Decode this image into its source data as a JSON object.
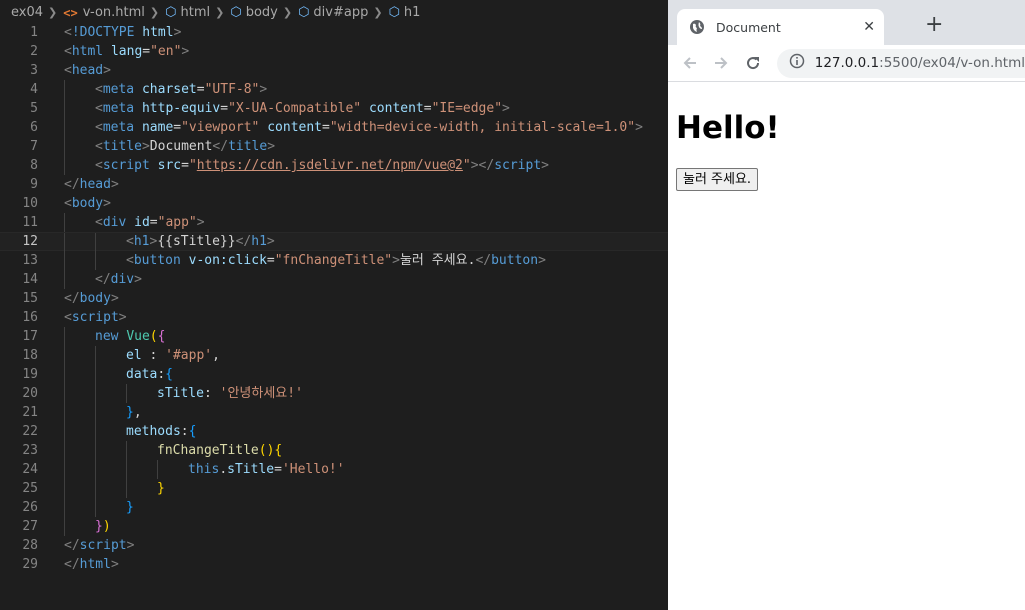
{
  "editor": {
    "breadcrumb": {
      "folder": "ex04",
      "file": "v-on.html",
      "path": [
        "html",
        "body",
        "div#app",
        "h1"
      ]
    },
    "current_line": 12,
    "lines": [
      {
        "n": "1",
        "indent": 0,
        "tokens": [
          [
            "br",
            "<"
          ],
          [
            "tag",
            "!DOCTYPE"
          ],
          [
            "txt",
            " "
          ],
          [
            "attr",
            "html"
          ],
          [
            "br",
            ">"
          ]
        ]
      },
      {
        "n": "2",
        "indent": 0,
        "tokens": [
          [
            "br",
            "<"
          ],
          [
            "tag",
            "html"
          ],
          [
            "txt",
            " "
          ],
          [
            "attr",
            "lang"
          ],
          [
            "txt",
            "="
          ],
          [
            "str",
            "\"en\""
          ],
          [
            "br",
            ">"
          ]
        ]
      },
      {
        "n": "3",
        "indent": 0,
        "tokens": [
          [
            "br",
            "<"
          ],
          [
            "tag",
            "head"
          ],
          [
            "br",
            ">"
          ]
        ]
      },
      {
        "n": "4",
        "indent": 1,
        "tokens": [
          [
            "br",
            "<"
          ],
          [
            "tag",
            "meta"
          ],
          [
            "txt",
            " "
          ],
          [
            "attr",
            "charset"
          ],
          [
            "txt",
            "="
          ],
          [
            "str",
            "\"UTF-8\""
          ],
          [
            "br",
            ">"
          ]
        ]
      },
      {
        "n": "5",
        "indent": 1,
        "tokens": [
          [
            "br",
            "<"
          ],
          [
            "tag",
            "meta"
          ],
          [
            "txt",
            " "
          ],
          [
            "attr",
            "http-equiv"
          ],
          [
            "txt",
            "="
          ],
          [
            "str",
            "\"X-UA-Compatible\""
          ],
          [
            "txt",
            " "
          ],
          [
            "attr",
            "content"
          ],
          [
            "txt",
            "="
          ],
          [
            "str",
            "\"IE=edge\""
          ],
          [
            "br",
            ">"
          ]
        ]
      },
      {
        "n": "6",
        "indent": 1,
        "tokens": [
          [
            "br",
            "<"
          ],
          [
            "tag",
            "meta"
          ],
          [
            "txt",
            " "
          ],
          [
            "attr",
            "name"
          ],
          [
            "txt",
            "="
          ],
          [
            "str",
            "\"viewport\""
          ],
          [
            "txt",
            " "
          ],
          [
            "attr",
            "content"
          ],
          [
            "txt",
            "="
          ],
          [
            "str",
            "\"width=device-width, initial-scale=1.0\""
          ],
          [
            "br",
            ">"
          ]
        ]
      },
      {
        "n": "7",
        "indent": 1,
        "tokens": [
          [
            "br",
            "<"
          ],
          [
            "tag",
            "title"
          ],
          [
            "br",
            ">"
          ],
          [
            "txt",
            "Document"
          ],
          [
            "br",
            "</"
          ],
          [
            "tag",
            "title"
          ],
          [
            "br",
            ">"
          ]
        ]
      },
      {
        "n": "8",
        "indent": 1,
        "tokens": [
          [
            "br",
            "<"
          ],
          [
            "tag",
            "script"
          ],
          [
            "txt",
            " "
          ],
          [
            "attr",
            "src"
          ],
          [
            "txt",
            "="
          ],
          [
            "str",
            "\""
          ],
          [
            "url",
            "https://cdn.jsdelivr.net/npm/vue@2"
          ],
          [
            "str",
            "\""
          ],
          [
            "br",
            "></"
          ],
          [
            "tag",
            "script"
          ],
          [
            "br",
            ">"
          ]
        ]
      },
      {
        "n": "9",
        "indent": 0,
        "tokens": [
          [
            "br",
            "</"
          ],
          [
            "tag",
            "head"
          ],
          [
            "br",
            ">"
          ]
        ]
      },
      {
        "n": "10",
        "indent": 0,
        "tokens": [
          [
            "br",
            "<"
          ],
          [
            "tag",
            "body"
          ],
          [
            "br",
            ">"
          ]
        ]
      },
      {
        "n": "11",
        "indent": 1,
        "tokens": [
          [
            "br",
            "<"
          ],
          [
            "tag",
            "div"
          ],
          [
            "txt",
            " "
          ],
          [
            "attr",
            "id"
          ],
          [
            "txt",
            "="
          ],
          [
            "str",
            "\"app\""
          ],
          [
            "br",
            ">"
          ]
        ]
      },
      {
        "n": "12",
        "indent": 2,
        "tokens": [
          [
            "br",
            "<"
          ],
          [
            "tag",
            "h1"
          ],
          [
            "br",
            ">"
          ],
          [
            "txt",
            "{{sTitle}}"
          ],
          [
            "br",
            "</"
          ],
          [
            "tag",
            "h1"
          ],
          [
            "br",
            ">"
          ]
        ]
      },
      {
        "n": "13",
        "indent": 2,
        "tokens": [
          [
            "br",
            "<"
          ],
          [
            "tag",
            "button"
          ],
          [
            "txt",
            " "
          ],
          [
            "attr",
            "v-on:click"
          ],
          [
            "txt",
            "="
          ],
          [
            "str",
            "\"fnChangeTitle\""
          ],
          [
            "br",
            ">"
          ],
          [
            "txt",
            "눌러 주세요."
          ],
          [
            "br",
            "</"
          ],
          [
            "tag",
            "button"
          ],
          [
            "br",
            ">"
          ]
        ]
      },
      {
        "n": "14",
        "indent": 1,
        "tokens": [
          [
            "br",
            "</"
          ],
          [
            "tag",
            "div"
          ],
          [
            "br",
            ">"
          ]
        ]
      },
      {
        "n": "15",
        "indent": 0,
        "tokens": [
          [
            "br",
            "</"
          ],
          [
            "tag",
            "body"
          ],
          [
            "br",
            ">"
          ]
        ]
      },
      {
        "n": "16",
        "indent": 0,
        "tokens": [
          [
            "br",
            "<"
          ],
          [
            "tag",
            "script"
          ],
          [
            "br",
            ">"
          ]
        ]
      },
      {
        "n": "17",
        "indent": 1,
        "tokens": [
          [
            "kw",
            "new"
          ],
          [
            "txt",
            " "
          ],
          [
            "cls",
            "Vue"
          ],
          [
            "p1",
            "("
          ],
          [
            "p2",
            "{"
          ]
        ]
      },
      {
        "n": "18",
        "indent": 2,
        "tokens": [
          [
            "prop",
            "el"
          ],
          [
            "txt",
            " : "
          ],
          [
            "str",
            "'#app'"
          ],
          [
            "txt",
            ","
          ]
        ]
      },
      {
        "n": "19",
        "indent": 2,
        "tokens": [
          [
            "prop",
            "data"
          ],
          [
            "txt",
            ":"
          ],
          [
            "p3",
            "{"
          ]
        ]
      },
      {
        "n": "20",
        "indent": 3,
        "tokens": [
          [
            "prop",
            "sTitle"
          ],
          [
            "txt",
            ": "
          ],
          [
            "str",
            "'안녕하세요!'"
          ]
        ]
      },
      {
        "n": "21",
        "indent": 2,
        "tokens": [
          [
            "p3",
            "}"
          ],
          [
            "txt",
            ","
          ]
        ]
      },
      {
        "n": "22",
        "indent": 2,
        "tokens": [
          [
            "prop",
            "methods"
          ],
          [
            "txt",
            ":"
          ],
          [
            "p3",
            "{"
          ]
        ]
      },
      {
        "n": "23",
        "indent": 3,
        "tokens": [
          [
            "fn",
            "fnChangeTitle"
          ],
          [
            "p1",
            "()"
          ],
          [
            "p1",
            "{"
          ]
        ]
      },
      {
        "n": "24",
        "indent": 4,
        "tokens": [
          [
            "kw",
            "this"
          ],
          [
            "txt",
            "."
          ],
          [
            "prop",
            "sTitle"
          ],
          [
            "txt",
            "="
          ],
          [
            "str",
            "'Hello!'"
          ]
        ]
      },
      {
        "n": "25",
        "indent": 3,
        "tokens": [
          [
            "p1",
            "}"
          ]
        ]
      },
      {
        "n": "26",
        "indent": 2,
        "tokens": [
          [
            "p3",
            "}"
          ]
        ]
      },
      {
        "n": "27",
        "indent": 1,
        "tokens": [
          [
            "p2",
            "}"
          ],
          [
            "p1",
            ")"
          ]
        ]
      },
      {
        "n": "28",
        "indent": 0,
        "tokens": [
          [
            "br",
            "</"
          ],
          [
            "tag",
            "script"
          ],
          [
            "br",
            ">"
          ]
        ]
      },
      {
        "n": "29",
        "indent": 0,
        "tokens": [
          [
            "br",
            "</"
          ],
          [
            "tag",
            "html"
          ],
          [
            "br",
            ">"
          ]
        ]
      }
    ]
  },
  "browser": {
    "tab_title": "Document",
    "tab_close": "✕",
    "new_tab": "+",
    "url_host": "127.0.0.1",
    "url_rest": ":5500/ex04/v-on.html",
    "page_heading": "Hello!",
    "page_button": "눌러 주세요."
  }
}
